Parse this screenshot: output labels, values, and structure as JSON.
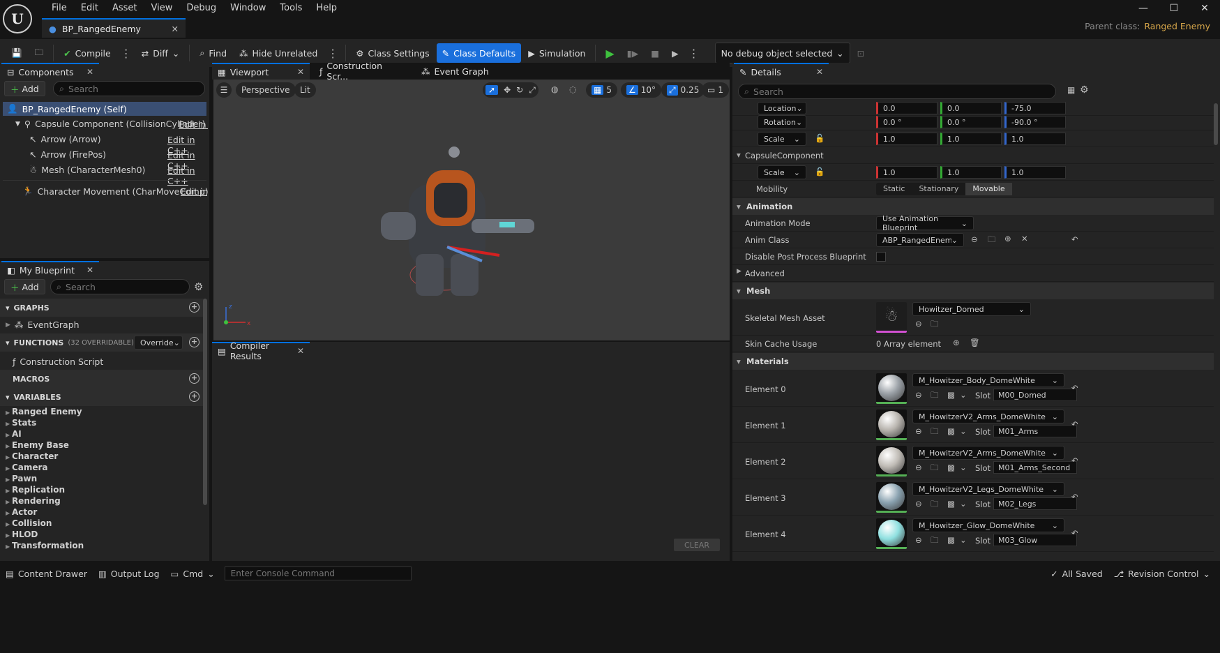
{
  "app": {
    "logo": "U"
  },
  "menu": [
    "File",
    "Edit",
    "Asset",
    "View",
    "Debug",
    "Window",
    "Tools",
    "Help"
  ],
  "document_tab": "BP_RangedEnemy",
  "parent_class": {
    "label": "Parent class:",
    "value": "Ranged Enemy"
  },
  "toolbar": {
    "compile": "Compile",
    "diff": "Diff",
    "find": "Find",
    "hide_unrelated": "Hide Unrelated",
    "class_settings": "Class Settings",
    "class_defaults": "Class Defaults",
    "simulation": "Simulation",
    "debug_object": "No debug object selected"
  },
  "components": {
    "tab": "Components",
    "add": "Add",
    "search_placeholder": "Search",
    "items": [
      {
        "label": "BP_RangedEnemy (Self)",
        "edit": ""
      },
      {
        "label": "Capsule Component (CollisionCylinder)",
        "edit": "Edit in C"
      },
      {
        "label": "Arrow (Arrow)",
        "edit": "Edit in C++"
      },
      {
        "label": "Arrow (FirePos)",
        "edit": "Edit in C++"
      },
      {
        "label": "Mesh (CharacterMesh0)",
        "edit": "Edit in C++"
      },
      {
        "label": "Character Movement (CharMoveComp)",
        "edit": "Edit in C"
      }
    ]
  },
  "my_blueprint": {
    "tab": "My Blueprint",
    "add": "Add",
    "search_placeholder": "Search",
    "graphs": "GRAPHS",
    "event_graph": "EventGraph",
    "functions": "FUNCTIONS",
    "functions_note": "(32 OVERRIDABLE)",
    "override": "Override",
    "construction_script": "Construction Script",
    "macros": "MACROS",
    "variables": "VARIABLES",
    "variable_categories": [
      "Ranged Enemy",
      "Stats",
      "AI",
      "Enemy Base",
      "Character",
      "Camera",
      "Pawn",
      "Replication",
      "Rendering",
      "Actor",
      "Collision",
      "HLOD",
      "Transformation"
    ]
  },
  "center_tabs": {
    "viewport": "Viewport",
    "construction": "Construction Scr...",
    "event_graph": "Event Graph"
  },
  "viewport": {
    "perspective": "Perspective",
    "lit": "Lit",
    "grid": "5",
    "angle": "10°",
    "scale": "0.25",
    "camera": "1"
  },
  "compiler": {
    "tab": "Compiler Results",
    "clear": "CLEAR"
  },
  "details": {
    "tab": "Details",
    "search_placeholder": "Search",
    "location": {
      "label": "Location",
      "x": "0.0",
      "y": "0.0",
      "z": "-75.0"
    },
    "rotation": {
      "label": "Rotation",
      "x": "0.0 °",
      "y": "0.0 °",
      "z": "-90.0 °"
    },
    "scale": {
      "label": "Scale",
      "x": "1.0",
      "y": "1.0",
      "z": "1.0"
    },
    "capsule_header": "CapsuleComponent",
    "capsule_scale": {
      "label": "Scale",
      "x": "1.0",
      "y": "1.0",
      "z": "1.0"
    },
    "mobility": {
      "label": "Mobility",
      "options": [
        "Static",
        "Stationary",
        "Movable"
      ],
      "selected": "Movable"
    },
    "animation_header": "Animation",
    "animation_mode": {
      "label": "Animation Mode",
      "value": "Use Animation Blueprint"
    },
    "anim_class": {
      "label": "Anim Class",
      "value": "ABP_RangedEnemy_C"
    },
    "disable_pp": {
      "label": "Disable Post Process Blueprint"
    },
    "advanced": "Advanced",
    "mesh_header": "Mesh",
    "skeletal_mesh": {
      "label": "Skeletal Mesh Asset",
      "value": "Howitzer_Domed"
    },
    "skin_cache": {
      "label": "Skin Cache Usage",
      "value": "0 Array element"
    },
    "materials_header": "Materials",
    "materials": [
      {
        "label": "Element 0",
        "material": "M_Howitzer_Body_DomeWhite",
        "slot": "M00_Domed",
        "color": "#9aa0a6"
      },
      {
        "label": "Element 1",
        "material": "M_HowitzerV2_Arms_DomeWhite",
        "slot": "M01_Arms",
        "color": "#b8b4ae"
      },
      {
        "label": "Element 2",
        "material": "M_HowitzerV2_Arms_DomeWhite",
        "slot": "M01_Arms_Second",
        "color": "#c0bcb6"
      },
      {
        "label": "Element 3",
        "material": "M_HowitzerV2_Legs_DomeWhite",
        "slot": "M02_Legs",
        "color": "#8aa2b0"
      },
      {
        "label": "Element 4",
        "material": "M_Howitzer_Glow_DomeWhite",
        "slot": "M03_Glow",
        "color": "#8fe0e0"
      }
    ],
    "slot_label": "Slot"
  },
  "status": {
    "content_drawer": "Content Drawer",
    "output_log": "Output Log",
    "cmd": "Cmd",
    "console_placeholder": "Enter Console Command",
    "all_saved": "All Saved",
    "revision_control": "Revision Control"
  },
  "colors": {
    "accent": "#0070e0",
    "active_button": "#1a6fdc",
    "parent_class": "#d6a64a",
    "play": "#3ec13e"
  }
}
